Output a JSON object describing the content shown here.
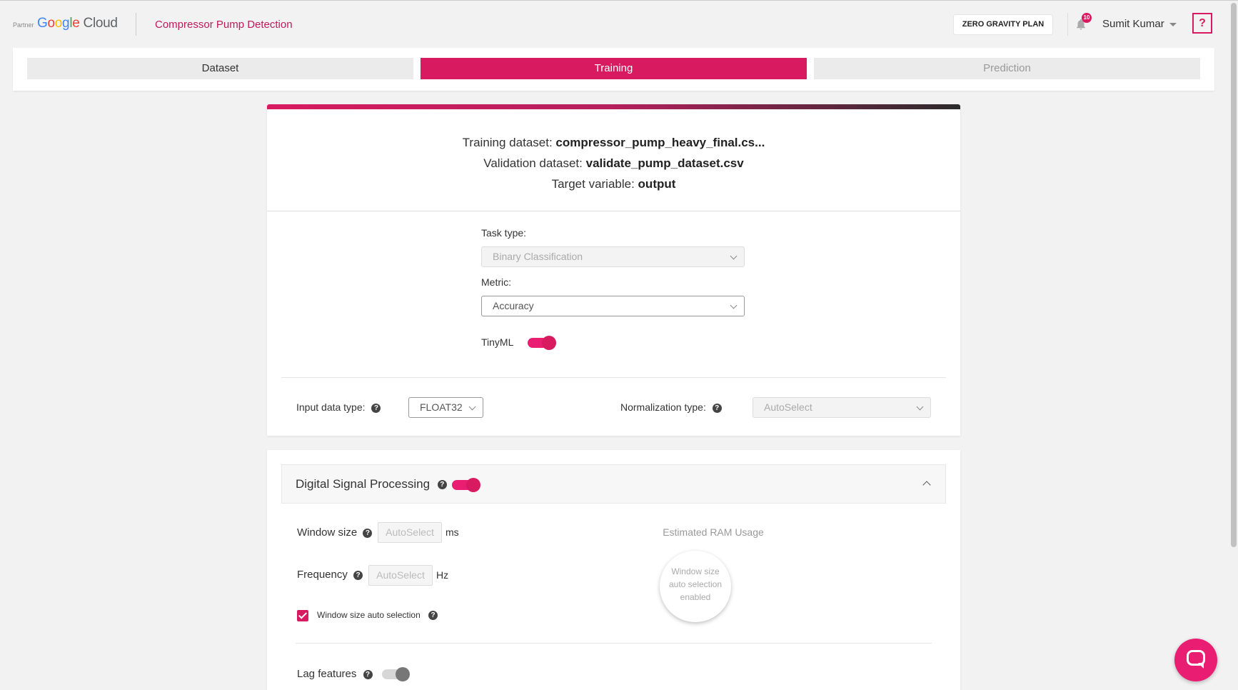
{
  "header": {
    "partner": "Partner",
    "brand_google": [
      "G",
      "o",
      "o",
      "g",
      "l",
      "e"
    ],
    "brand_cloud": "Cloud",
    "app_title": "Compressor Pump Detection",
    "plan_label": "ZERO GRAVITY PLAN",
    "notification_count": "10",
    "user_name": "Sumit Kumar",
    "help_label": "?"
  },
  "tabs": [
    {
      "label": "Dataset",
      "state": "inactive"
    },
    {
      "label": "Training",
      "state": "active"
    },
    {
      "label": "Prediction",
      "state": "disabled"
    }
  ],
  "datasets": {
    "training_label": "Training dataset: ",
    "training_value": "compressor_pump_heavy_final.cs...",
    "validation_label": "Validation dataset: ",
    "validation_value": "validate_pump_dataset.csv",
    "target_label": "Target variable: ",
    "target_value": "output"
  },
  "config": {
    "task_type_label": "Task type:",
    "task_type_value": "Binary Classification",
    "metric_label": "Metric:",
    "metric_value": "Accuracy",
    "tinyml_label": "TinyML",
    "tinyml_on": true,
    "input_type_label": "Input data type:",
    "input_type_value": "FLOAT32",
    "normalization_label": "Normalization type:",
    "normalization_value": "AutoSelect"
  },
  "dsp": {
    "title": "Digital Signal Processing",
    "enabled": true,
    "window_label": "Window size",
    "window_placeholder": "AutoSelect",
    "window_unit": "ms",
    "frequency_label": "Frequency",
    "frequency_placeholder": "AutoSelect",
    "frequency_unit": "Hz",
    "auto_selection_label": "Window size auto selection",
    "auto_selection_checked": true,
    "ram_title": "Estimated RAM Usage",
    "ram_line1": "Window size",
    "ram_line2": "auto selection",
    "ram_line3": "enabled",
    "lag_label": "Lag features",
    "lag_on": false
  },
  "colors": {
    "accent": "#d81b60",
    "brand_pink": "#c2185b"
  }
}
